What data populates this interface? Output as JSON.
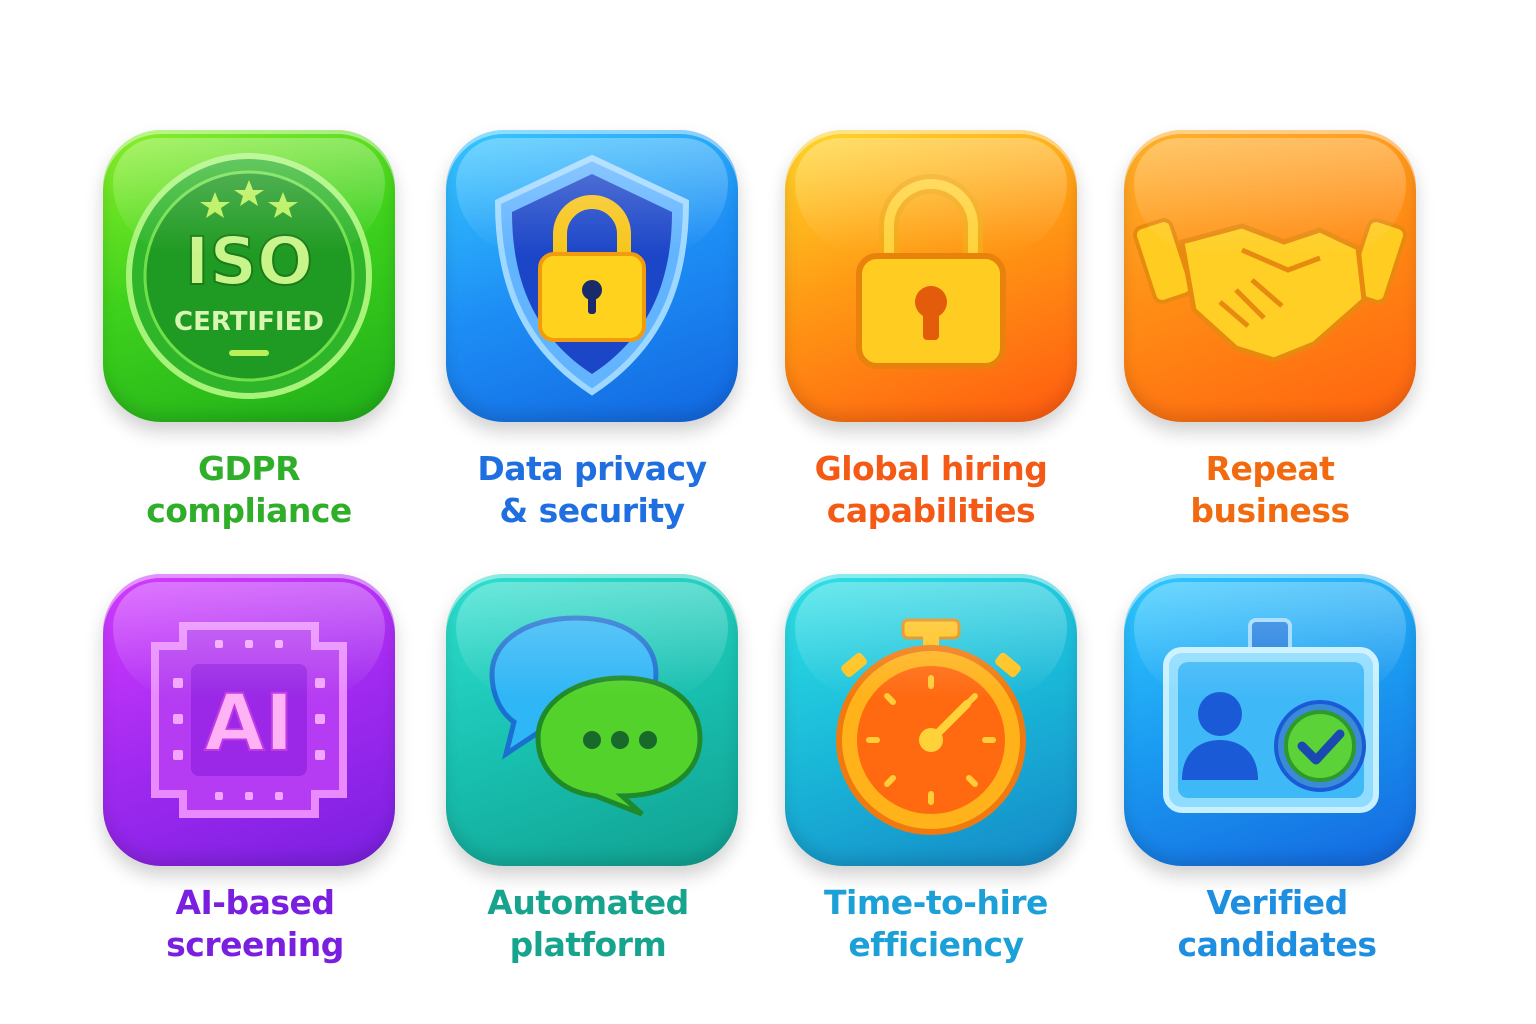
{
  "colors": {
    "gdpr": "#2fae2a",
    "privacy": "#1f6fe0",
    "global": "#f45a16",
    "repeat": "#f26a10",
    "ai": "#7a1fe0",
    "automated": "#17a48e",
    "time": "#1ba0d8",
    "verified": "#1e8fe0"
  },
  "badges": [
    {
      "icon": "iso-certified-icon",
      "iso_text": "ISO",
      "certified_text": "CERTIFIED",
      "caption": [
        "GDPR",
        "compliance"
      ]
    },
    {
      "icon": "shield-lock-icon",
      "caption": [
        "Data privacy",
        "& security"
      ]
    },
    {
      "icon": "padlock-icon",
      "caption": [
        "Global hiring",
        "capabilities"
      ]
    },
    {
      "icon": "handshake-icon",
      "caption": [
        "Repeat",
        "business"
      ]
    },
    {
      "icon": "ai-chip-icon",
      "chip_text": "AI",
      "caption": [
        "AI-based",
        "screening"
      ]
    },
    {
      "icon": "chat-bubbles-icon",
      "caption": [
        "Automated",
        "platform"
      ]
    },
    {
      "icon": "stopwatch-icon",
      "caption": [
        "Time-to-hire",
        "efficiency"
      ]
    },
    {
      "icon": "verified-id-card-icon",
      "caption": [
        "Verified",
        "candidates"
      ]
    }
  ]
}
